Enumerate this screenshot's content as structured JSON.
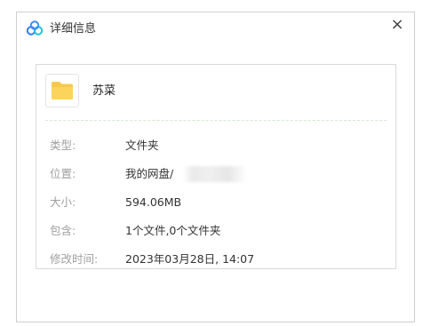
{
  "dialog": {
    "title": "详细信息",
    "close_glyph": "×",
    "app_icon": "baidu-netdisk-cloud-icon"
  },
  "file": {
    "icon": "folder-icon",
    "name": "苏菜"
  },
  "properties": [
    {
      "label": "类型:",
      "value": "文件夹"
    },
    {
      "label": "位置:",
      "value": "我的网盘/"
    },
    {
      "label": "大小:",
      "value": "594.06MB"
    },
    {
      "label": "包含:",
      "value": "1个文件,0个文件夹"
    },
    {
      "label": "修改时间:",
      "value": "2023年03月28日, 14:07"
    }
  ],
  "colors": {
    "folder": "#f7c94b",
    "icon_blue": "#2f7bf6",
    "label": "#a0a0a0",
    "value": "#333333"
  }
}
